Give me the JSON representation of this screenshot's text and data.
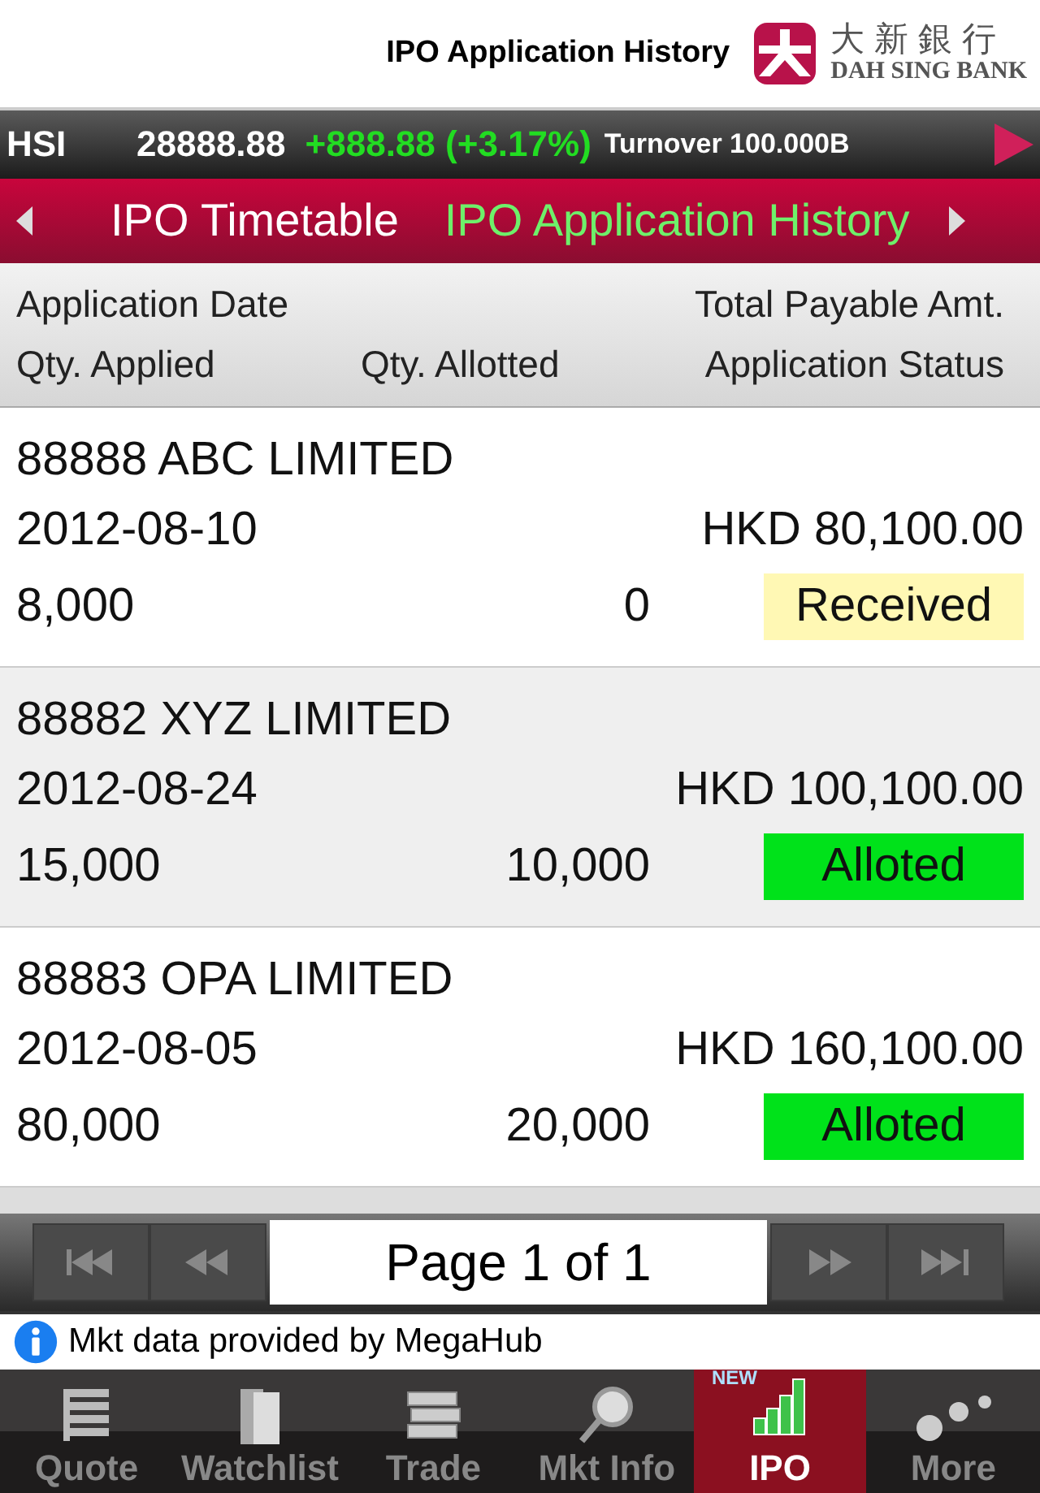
{
  "header": {
    "title": "IPO Application History",
    "logo_chinese": "大新銀行",
    "logo_english": "DAH SING BANK"
  },
  "ticker": {
    "index": "HSI",
    "value": "28888.88",
    "change": "+888.88 (+3.17%)",
    "turnover": "Turnover 100.000B"
  },
  "tabs": [
    {
      "label": "IPO Timetable",
      "selected": false
    },
    {
      "label": "IPO Application History",
      "selected": true
    }
  ],
  "columns": {
    "row1": [
      "Application Date",
      "Total Payable Amt."
    ],
    "row2": [
      "Qty. Applied",
      "Qty. Allotted",
      "Application Status"
    ]
  },
  "applications": [
    {
      "name": "88888 ABC LIMITED",
      "date": "2012-08-10",
      "amount": "HKD 80,100.00",
      "qty_applied": "8,000",
      "qty_allotted": "0",
      "status": "Received",
      "color": "#fff8b4"
    },
    {
      "name": "88882 XYZ LIMITED",
      "date": "2012-08-24",
      "amount": "HKD 100,100.00",
      "qty_applied": "15,000",
      "qty_allotted": "10,000",
      "status": "Alloted",
      "color": "#00e21a"
    },
    {
      "name": "88883 OPA LIMITED",
      "date": "2012-08-05",
      "amount": "HKD 160,100.00",
      "qty_applied": "80,000",
      "qty_allotted": "20,000",
      "status": "Alloted",
      "color": "#00e21a"
    }
  ],
  "pager": {
    "label": "Page 1 of 1"
  },
  "info": {
    "text": "Mkt data provided by MegaHub"
  },
  "tab_bar": [
    {
      "label": "Quote",
      "kind": "quote",
      "selected": false
    },
    {
      "label": "Watchlist",
      "kind": "watchlist",
      "selected": false
    },
    {
      "label": "Trade",
      "kind": "trade",
      "selected": false
    },
    {
      "label": "Mkt Info",
      "kind": "info",
      "selected": false
    },
    {
      "label": "IPO",
      "kind": "ipo",
      "selected": true,
      "badge": "NEW"
    },
    {
      "label": "More",
      "kind": "more",
      "selected": false
    }
  ]
}
